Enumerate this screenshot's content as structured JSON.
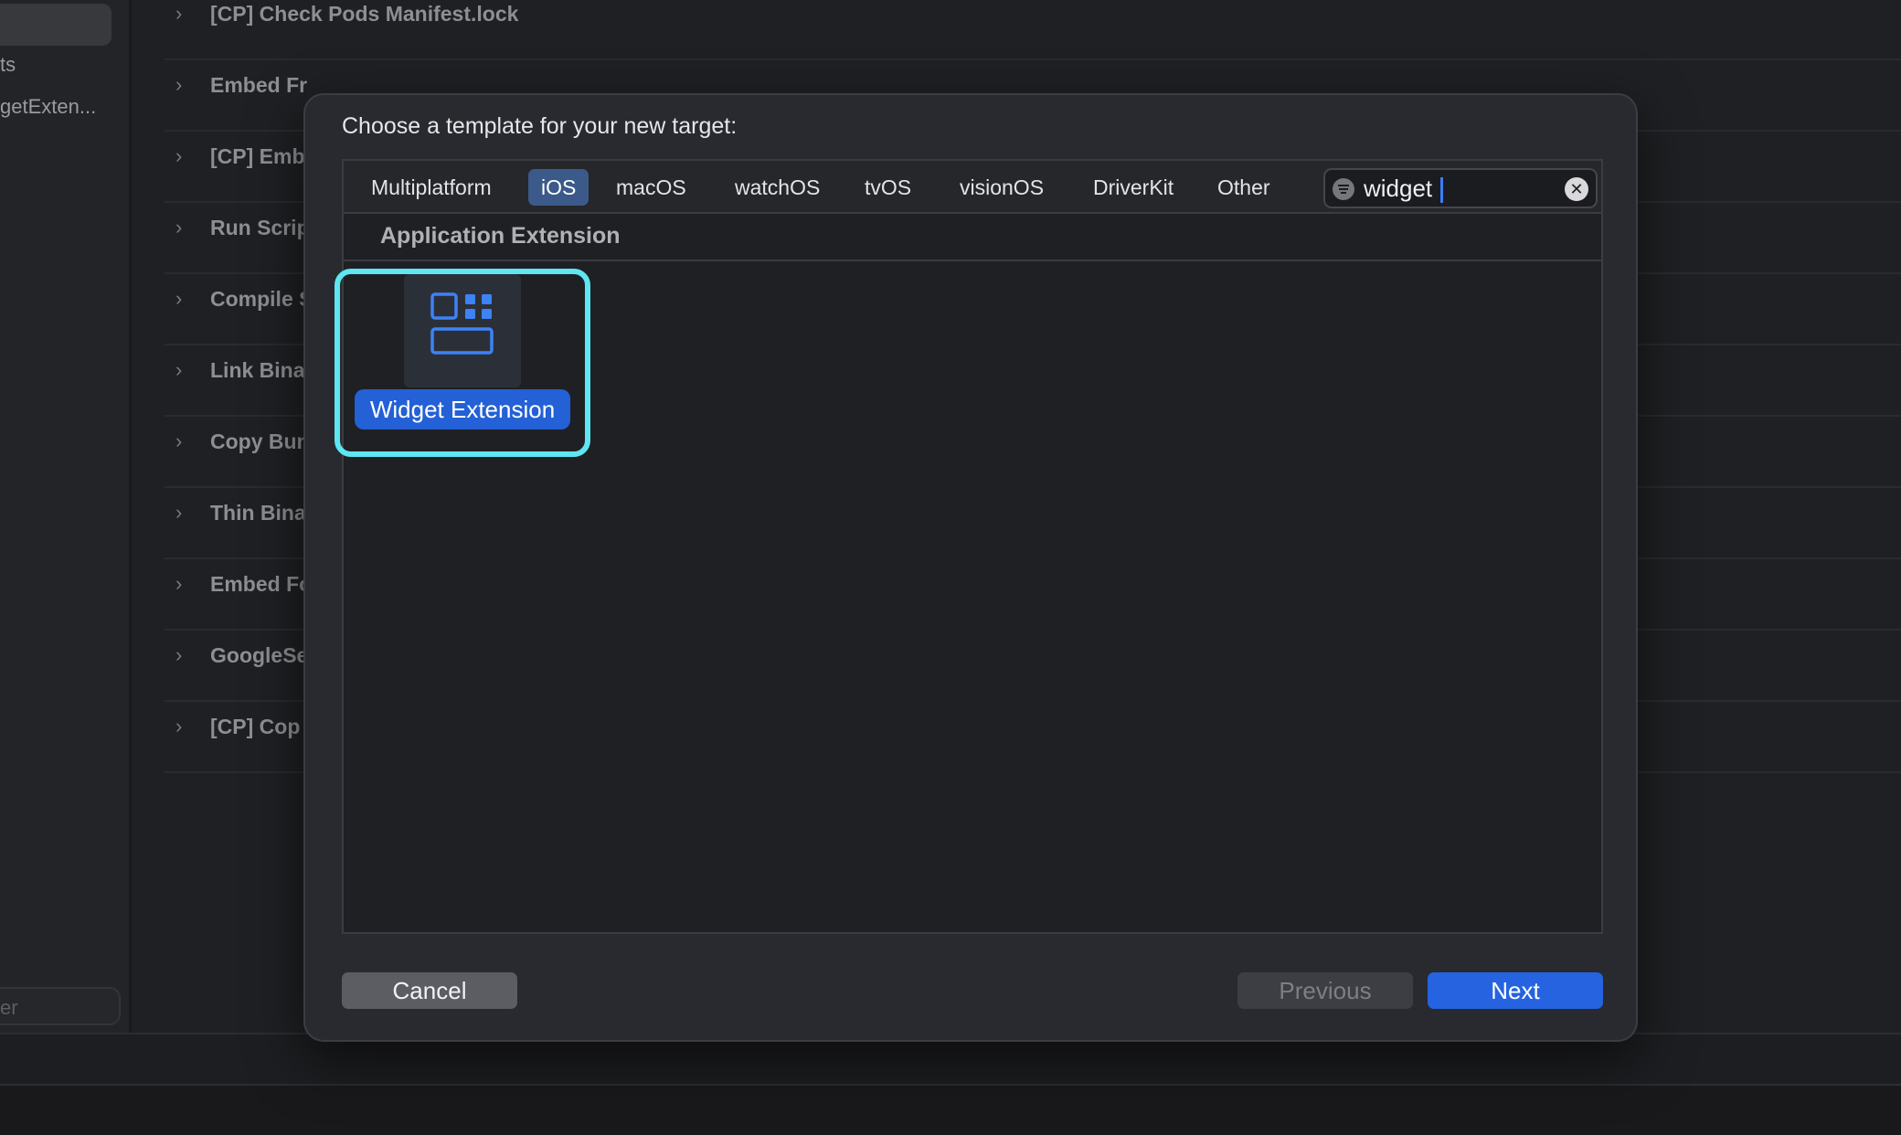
{
  "sidebar": {
    "fragment_1": "ts",
    "fragment_2": "getExten...",
    "filter_fragment": "er"
  },
  "build_phases": [
    "[CP] Check Pods Manifest.lock",
    "Embed Fr",
    "[CP] Emb",
    "Run Scrip",
    "Compile S",
    "Link Bina",
    "Copy Bun",
    "Thin Bina",
    "Embed Fo",
    "GoogleSe",
    "[CP] Cop"
  ],
  "dialog": {
    "title": "Choose a template for your new target:",
    "tabs": [
      "Multiplatform",
      "iOS",
      "macOS",
      "watchOS",
      "tvOS",
      "visionOS",
      "DriverKit",
      "Other"
    ],
    "active_tab": "iOS",
    "search": {
      "value": "widget"
    },
    "section_title": "Application Extension",
    "templates": [
      {
        "label": "Widget Extension",
        "icon": "widget-icon",
        "selected": true
      }
    ],
    "buttons": {
      "cancel": "Cancel",
      "previous": "Previous",
      "next": "Next"
    }
  },
  "colors": {
    "accent": "#2563e0",
    "highlight": "#5ee6f2",
    "active_tab": "#3b5a8a"
  }
}
